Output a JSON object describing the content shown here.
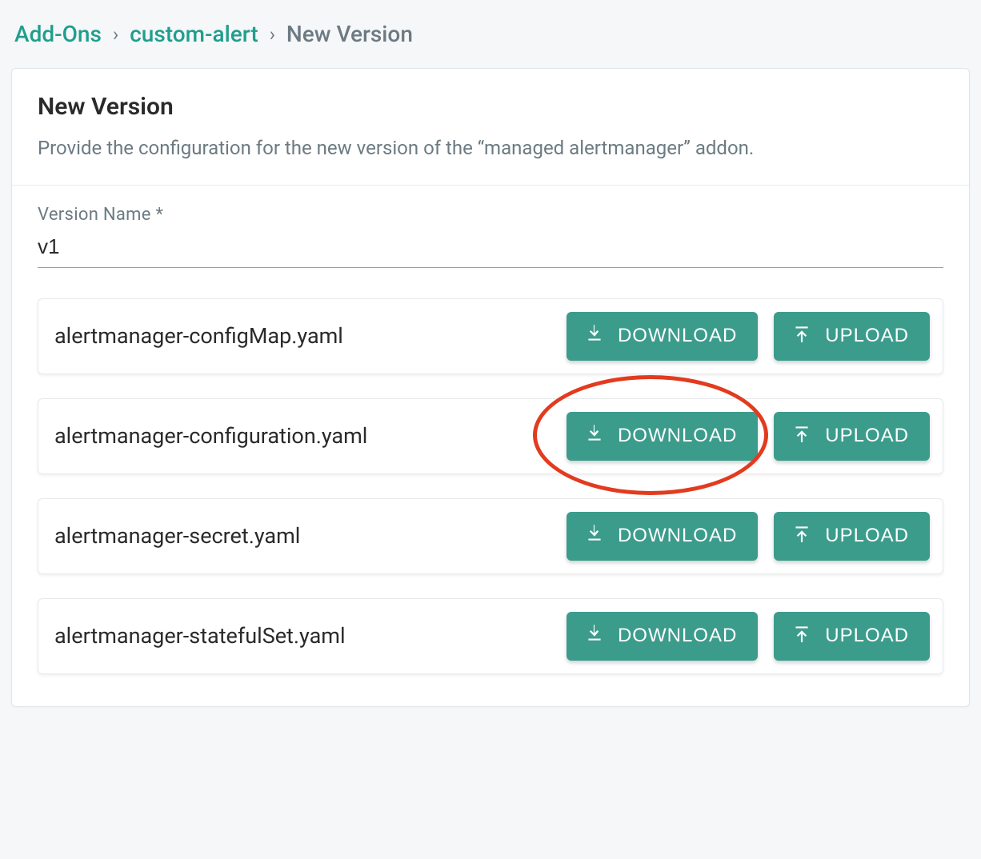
{
  "breadcrumb": {
    "items": [
      {
        "label": "Add-Ons",
        "link": true
      },
      {
        "label": "custom-alert",
        "link": true
      },
      {
        "label": "New Version",
        "link": false
      }
    ],
    "separator": "›"
  },
  "header": {
    "title": "New Version",
    "description": "Provide the configuration for the new version of the “managed alertmanager” addon."
  },
  "form": {
    "versionName": {
      "label": "Version Name *",
      "value": "v1"
    }
  },
  "buttons": {
    "download": "DOWNLOAD",
    "upload": "UPLOAD"
  },
  "files": [
    {
      "name": "alertmanager-configMap.yaml",
      "highlighted": false
    },
    {
      "name": "alertmanager-configuration.yaml",
      "highlighted": true
    },
    {
      "name": "alertmanager-secret.yaml",
      "highlighted": false
    },
    {
      "name": "alertmanager-statefulSet.yaml",
      "highlighted": false
    }
  ],
  "colors": {
    "accent": "#3b9c8c",
    "link": "#1f9e8e",
    "highlight": "#e23b1f"
  }
}
